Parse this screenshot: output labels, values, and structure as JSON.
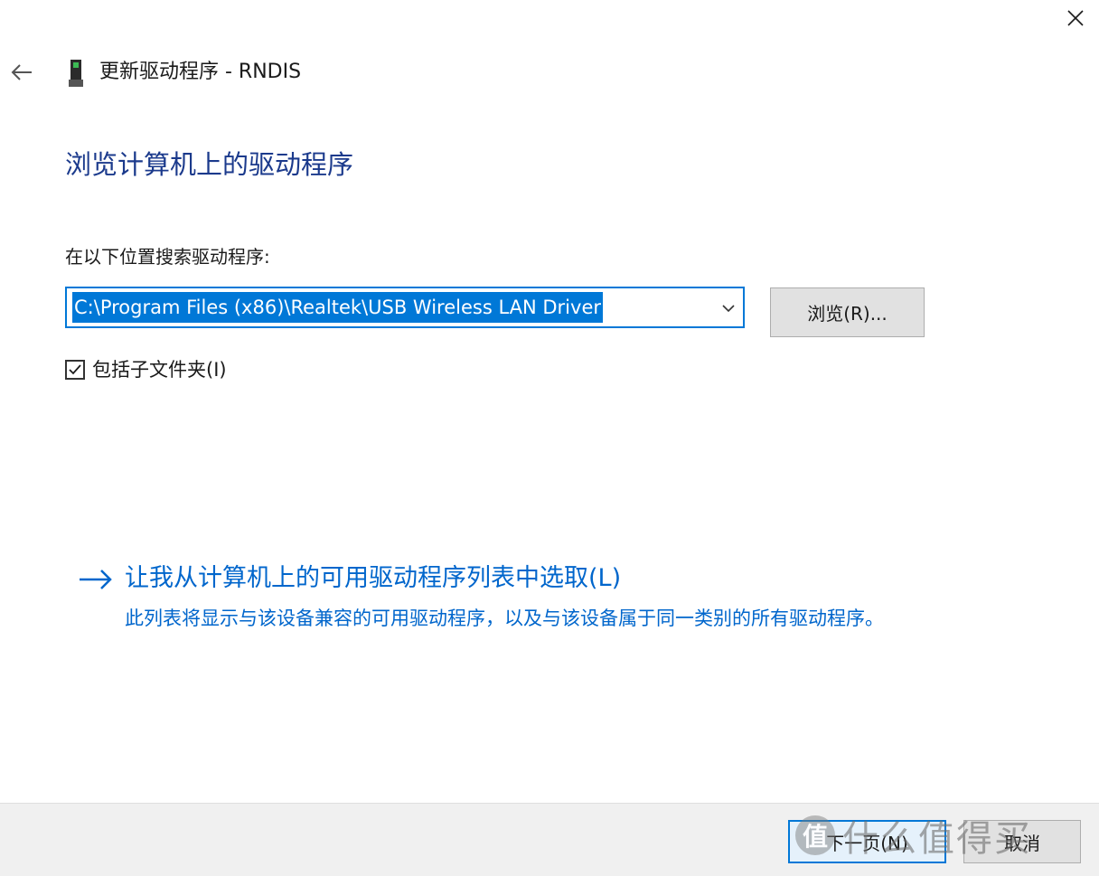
{
  "window": {
    "title": "更新驱动程序 - RNDIS",
    "icons": {
      "close": "close-icon",
      "back": "back-arrow-icon",
      "device": "usb-device-icon"
    }
  },
  "main": {
    "heading": "浏览计算机上的驱动程序",
    "search_label": "在以下位置搜索驱动程序:",
    "path_value": "C:\\Program Files (x86)\\Realtek\\USB Wireless LAN Driver",
    "browse_label": "浏览(R)...",
    "include_subfolders": {
      "label": "包括子文件夹(I)",
      "checked": true
    },
    "pick_link": {
      "title": "让我从计算机上的可用驱动程序列表中选取(L)",
      "description": "此列表将显示与该设备兼容的可用驱动程序，以及与该设备属于同一类别的所有驱动程序。"
    }
  },
  "footer": {
    "next_label": "下一页(N)",
    "cancel_label": "取消"
  },
  "watermark": {
    "logo_text": "值",
    "text": "什么值得买"
  },
  "colors": {
    "accent": "#0078d7",
    "heading": "#1b3a8c",
    "link": "#0066cc",
    "footer_bg": "#f0f0f0"
  }
}
